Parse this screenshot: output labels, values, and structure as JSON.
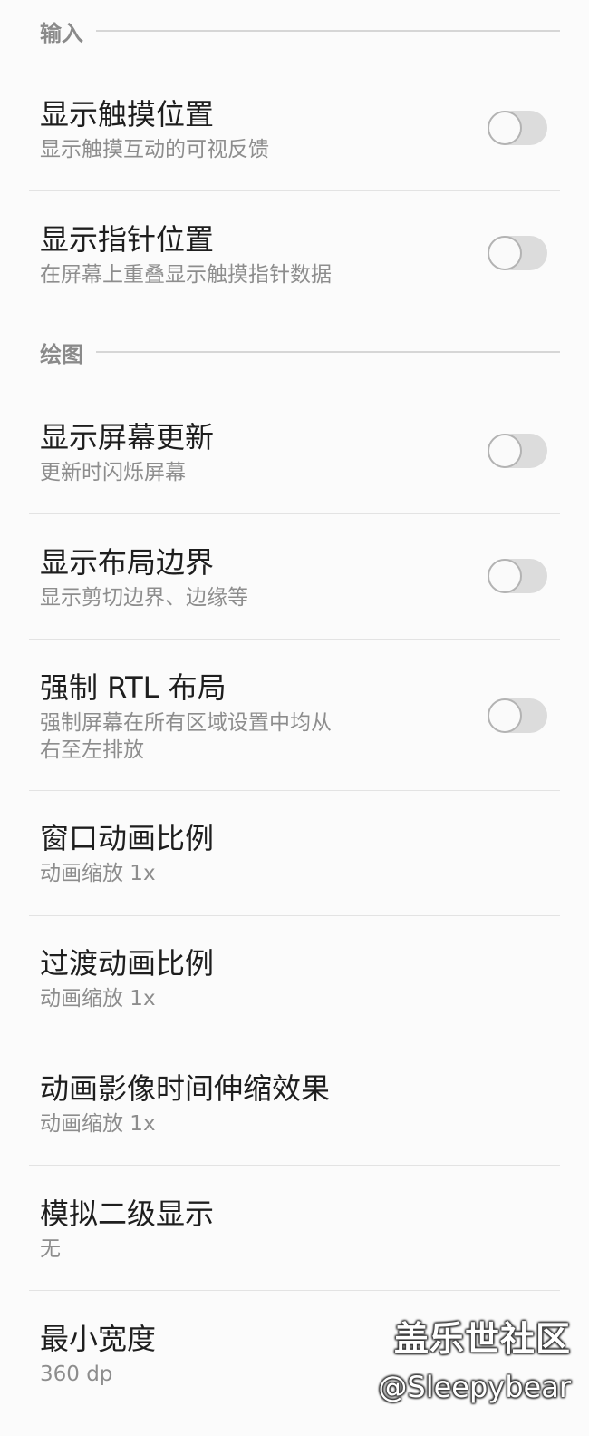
{
  "sections": {
    "input": {
      "title": "输入"
    },
    "drawing": {
      "title": "绘图"
    }
  },
  "settings": {
    "show_touches": {
      "title": "显示触摸位置",
      "subtitle": "显示触摸互动的可视反馈",
      "enabled": false
    },
    "pointer_location": {
      "title": "显示指针位置",
      "subtitle": "在屏幕上重叠显示触摸指针数据",
      "enabled": false
    },
    "show_surface_updates": {
      "title": "显示屏幕更新",
      "subtitle": "更新时闪烁屏幕",
      "enabled": false
    },
    "show_layout_bounds": {
      "title": "显示布局边界",
      "subtitle": "显示剪切边界、边缘等",
      "enabled": false
    },
    "force_rtl": {
      "title": "强制 RTL 布局",
      "subtitle": "强制屏幕在所有区域设置中均从右至左排放",
      "enabled": false
    },
    "window_animation_scale": {
      "title": "窗口动画比例",
      "subtitle": "动画缩放 1x"
    },
    "transition_animation_scale": {
      "title": "过渡动画比例",
      "subtitle": "动画缩放 1x"
    },
    "animator_duration_scale": {
      "title": "动画影像时间伸缩效果",
      "subtitle": "动画缩放 1x"
    },
    "simulate_secondary_display": {
      "title": "模拟二级显示",
      "subtitle": "无"
    },
    "smallest_width": {
      "title": "最小宽度",
      "subtitle": "360 dp"
    }
  },
  "watermark": {
    "title": "盖乐世社区",
    "user": "@Sleepybear"
  }
}
